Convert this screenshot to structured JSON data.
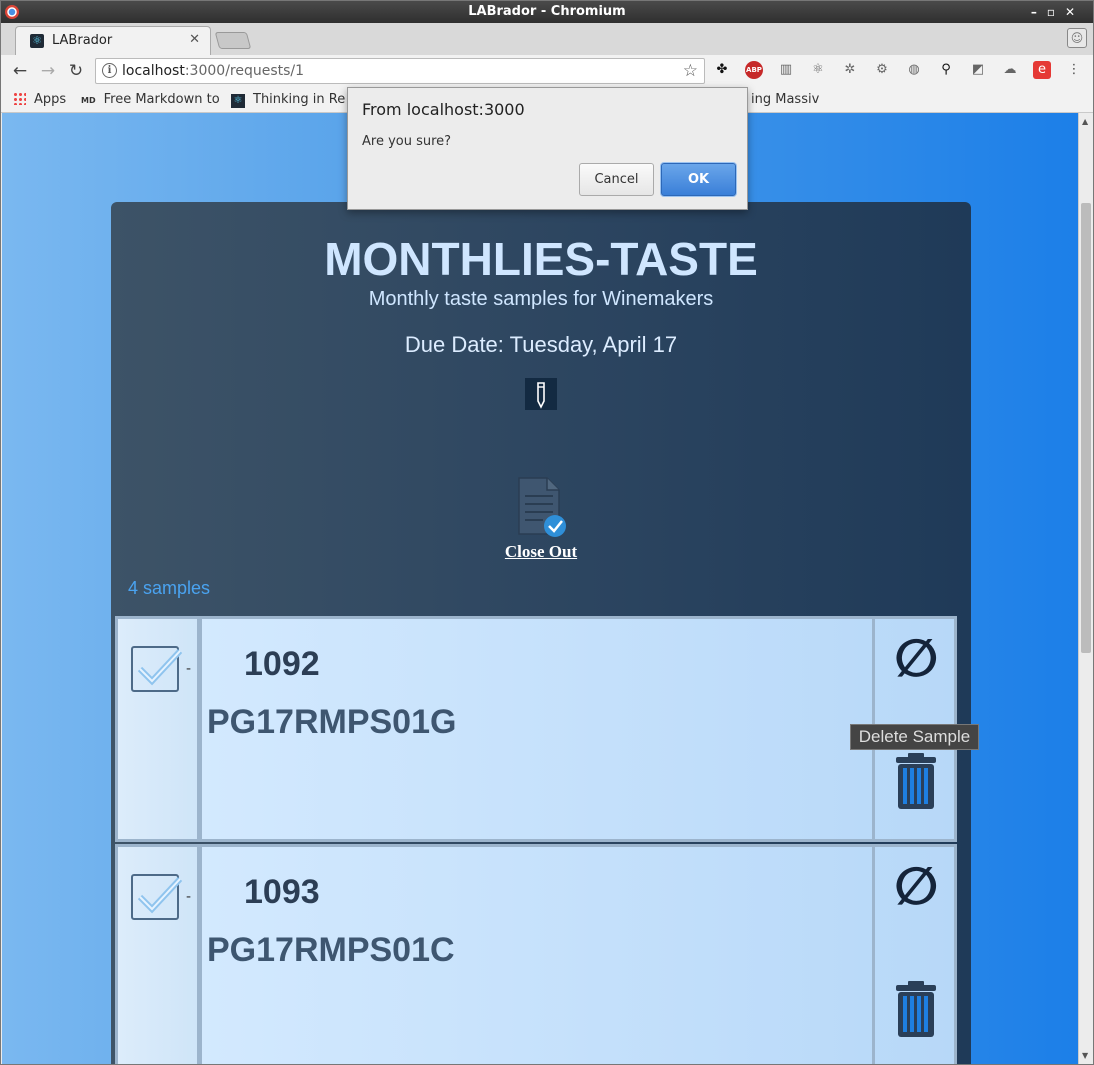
{
  "window": {
    "title": "LABrador - Chromium"
  },
  "tab": {
    "title": "LABrador"
  },
  "address": {
    "host": "localhost",
    "path": ":3000/requests/1"
  },
  "bookmarks": [
    {
      "label": "Apps"
    },
    {
      "label": "Free Markdown to"
    },
    {
      "label": "Thinking in Re"
    },
    {
      "label": "ing Massiv"
    }
  ],
  "dialog": {
    "title": "From localhost:3000",
    "message": "Are you sure?",
    "cancel_label": "Cancel",
    "ok_label": "OK"
  },
  "request": {
    "title": "MONTHLIES-TASTE",
    "subtitle": "Monthly taste samples for Winemakers",
    "due_date": "Due Date: Tuesday, April 17",
    "close_out_label": "Close Out",
    "sample_count": "4 samples"
  },
  "samples": [
    {
      "number": "1092",
      "code": "PG17RMPS01G",
      "dash": "-",
      "null_symbol": "∅"
    },
    {
      "number": "1093",
      "code": "PG17RMPS01C",
      "dash": "-",
      "null_symbol": "∅"
    }
  ],
  "tooltip": {
    "text": "Delete Sample"
  },
  "colors": {
    "page_gradient_start": "#7ab8f0",
    "page_gradient_end": "#1c7fe8",
    "card_background": "#2c4560",
    "title_text": "#cfe6ff",
    "row_background": "#c6e1fb",
    "trash_blue": "#1e7fe0",
    "ok_button": "#3a7fd8"
  }
}
